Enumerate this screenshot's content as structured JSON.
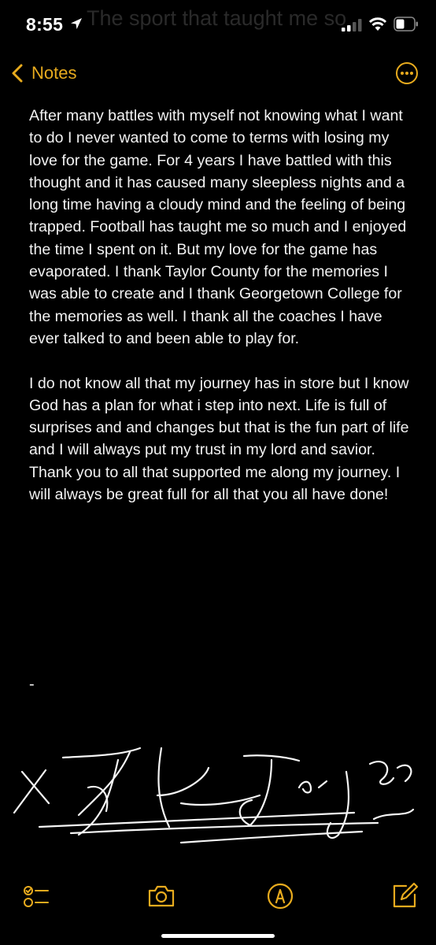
{
  "status_bar": {
    "time": "8:55",
    "icons": [
      "location-arrow-icon",
      "cellular-signal-icon",
      "wifi-icon",
      "battery-icon"
    ],
    "ghost_text": "The sport that taught me so much"
  },
  "nav": {
    "back_label": "Notes",
    "accent_color": "#e8ab1e",
    "icons": [
      "chevron-left-icon",
      "more-ellipsis-icon"
    ]
  },
  "note": {
    "paragraphs": [
      "After many battles with myself not knowing what I want to do I never wanted to come to terms with losing my love for the game. For 4 years I have battled with this thought and it has caused many sleepless nights and a long time having a cloudy mind and the feeling of being trapped. Football has taught me so much and I enjoyed the time I spent on it. But my love for the game has evaporated. I thank Taylor County for the memories I was able to create and I thank Georgetown College for the memories as well. I thank all the coaches I have ever talked to and been able to play for.",
      "I do not know all that my journey has in store but I know God has a plan for what i step into next. Life is full of surprises and and changes but that is the fun part of life and I will always put my trust in my lord and savior. Thank you to all that supported me along my journey. I will always be great full for all that you all have done!"
    ],
    "dash": "-"
  },
  "toolbar": {
    "icons": [
      "checklist-icon",
      "camera-icon",
      "markup-pen-icon",
      "compose-icon"
    ]
  }
}
